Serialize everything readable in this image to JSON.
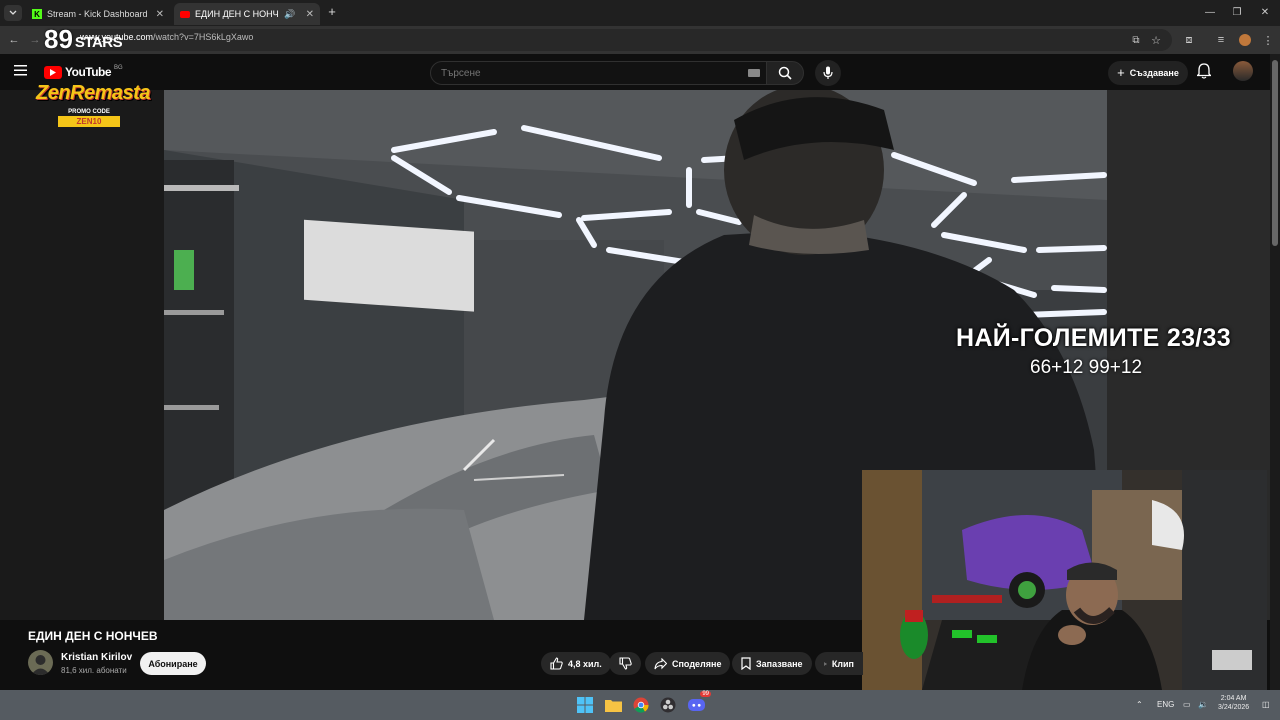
{
  "browser": {
    "tabs": [
      {
        "title": "Stream - Kick Dashboard",
        "active": false
      },
      {
        "title": "ЕДИН ДЕН С НОНЧЕВ - Yo",
        "active": true
      }
    ],
    "url_host": "www.youtube.com",
    "url_path": "/watch?v=7HS6kLgXawo"
  },
  "youtube": {
    "logo_text": "YouTube",
    "logo_region": "BG",
    "search_placeholder": "Търсене",
    "create_label": "Създаване"
  },
  "overlay": {
    "brand_89": "89",
    "brand_stars": "STARS",
    "sponsor_name": "ZenRemasta",
    "promo_label": "PROMO CODE",
    "promo_code": "ZEN10",
    "title": "НАЙ-ГОЛЕМИТЕ 23/33",
    "scores": "66+12 99+12"
  },
  "video": {
    "title": "ЕДИН ДЕН С НОНЧЕВ",
    "channel": "Kristian Kirilov",
    "subscribers": "81,6 хил. абонати",
    "subscribe_label": "Абониране",
    "likes": "4,8 хил.",
    "share_label": "Споделяне",
    "save_label": "Запазване",
    "clip_label": "Клип"
  },
  "taskbar": {
    "lang": "ENG",
    "clock_time": "2:04 AM",
    "clock_date": "3/24/2026",
    "discord_badge": "99"
  },
  "colors": {
    "youtube_red": "#ff0000",
    "kick_green": "#53fc18",
    "promo_yellow": "#f5c518"
  }
}
